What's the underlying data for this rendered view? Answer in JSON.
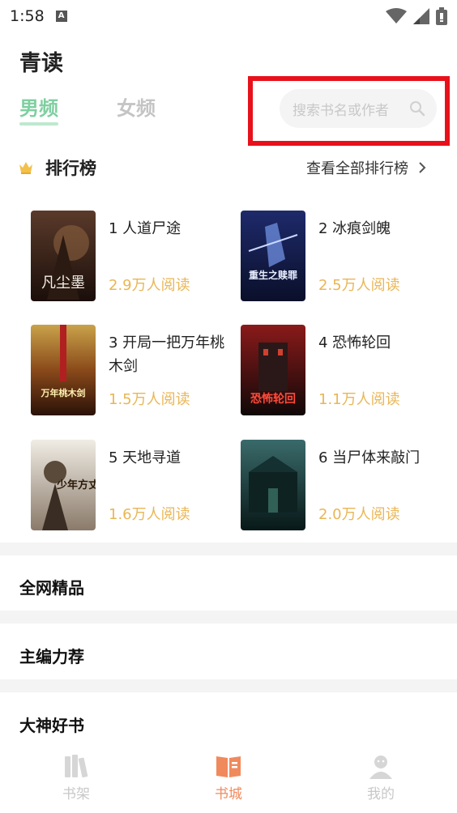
{
  "status_bar": {
    "time": "1:58",
    "notif_letter": "A"
  },
  "app": {
    "title": "青读"
  },
  "tabs": [
    {
      "label": "男频",
      "active": true
    },
    {
      "label": "女频",
      "active": false
    }
  ],
  "search": {
    "placeholder": "搜索书名或作者"
  },
  "ranking": {
    "title": "排行榜",
    "view_all": "查看全部排行榜",
    "books": [
      {
        "title": "1 人道尸途",
        "reads": "2.9万人阅读",
        "cover_text": "凡尘墨"
      },
      {
        "title": "2 冰痕剑魄",
        "reads": "2.5万人阅读",
        "cover_text": "重生之赎罪"
      },
      {
        "title": "3 开局一把万年桃木剑",
        "reads": "1.5万人阅读",
        "cover_text": "万年桃木剑"
      },
      {
        "title": "4 恐怖轮回",
        "reads": "1.1万人阅读",
        "cover_text": "恐怖轮回"
      },
      {
        "title": "5 天地寻道",
        "reads": "1.6万人阅读",
        "cover_text": "少年方丈"
      },
      {
        "title": "6 当尸体来敲门",
        "reads": "2.0万人阅读",
        "cover_text": ""
      }
    ]
  },
  "sections": [
    "全网精品",
    "主编力荐",
    "大神好书"
  ],
  "bottom_nav": [
    {
      "label": "书架",
      "active": false
    },
    {
      "label": "书城",
      "active": true
    },
    {
      "label": "我的",
      "active": false
    }
  ],
  "colors": {
    "accent_green": "#7fcfa0",
    "reads_gold": "#e9b655",
    "nav_active": "#f08a5d",
    "highlight_red": "#e8111b"
  }
}
